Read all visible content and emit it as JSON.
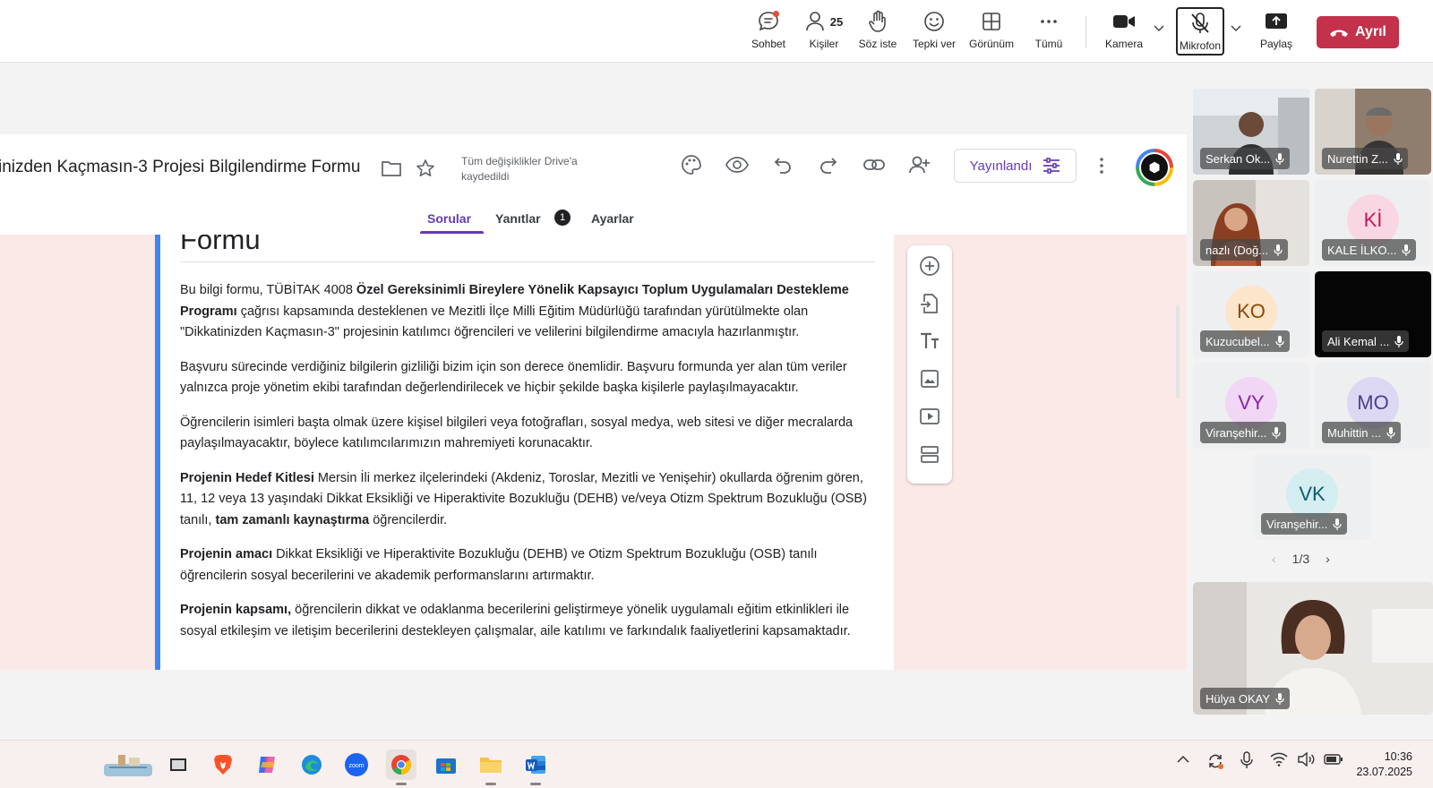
{
  "meeting_bar": {
    "chat": "Sohbet",
    "people": "Kişiler",
    "people_count": "25",
    "raise_hand": "Söz iste",
    "react": "Tepki ver",
    "view": "Görünüm",
    "more": "Tümü",
    "camera": "Kamera",
    "mic": "Mikrofon",
    "share": "Paylaş",
    "leave": "Ayrıl",
    "leave_color": "#c4314b"
  },
  "form_app": {
    "title": "inizden Kaçmasın-3 Projesi Bilgilendirme Formu",
    "saved_status": "Tüm değişiklikler Drive'a kaydedildi",
    "publish_label": "Yayınlandı",
    "accent_color": "#673ab7",
    "tabs": {
      "questions": "Sorular",
      "responses": "Yanıtlar",
      "responses_count": "1",
      "settings": "Ayarlar"
    },
    "form_heading": "Formu",
    "desc": {
      "p1_a": "Bu bilgi formu, TÜBİTAK 4008 ",
      "p1_b": "Özel Gereksinimli Bireylere Yönelik Kapsayıcı Toplum Uygulamaları Destekleme Programı",
      "p1_c": " çağrısı kapsamında desteklenen ve Mezitli İlçe Milli Eğitim Müdürlüğü tarafından yürütülmekte olan \"Dikkatinizden Kaçmasın-3\" projesinin katılımcı öğrencileri ve velilerini bilgilendirme amacıyla hazırlanmıştır.",
      "p2": "Başvuru sürecinde verdiğiniz bilgilerin gizliliği bizim için son derece önemlidir. Başvuru formunda yer alan tüm veriler yalnızca proje yönetim ekibi tarafından değerlendirilecek ve hiçbir şekilde başka kişilerle paylaşılmayacaktır.",
      "p3": "Öğrencilerin isimleri başta olmak üzere kişisel bilgileri veya fotoğrafları, sosyal medya, web sitesi ve diğer mecralarda paylaşılmayacaktır, böylece katılımcılarımızın mahremiyeti korunacaktır.",
      "p4_a": "Projenin Hedef Kitlesi",
      "p4_b": " Mersin İli merkez ilçelerindeki (Akdeniz, Toroslar, Mezitli ve Yenişehir) okullarda öğrenim gören, 11, 12 veya 13 yaşındaki Dikkat Eksikliği ve Hiperaktivite Bozukluğu (DEHB) ve/veya Otizm Spektrum Bozukluğu (OSB) tanılı, ",
      "p4_c": "tam zamanlı kaynaştırma",
      "p4_d": " öğrencilerdir.",
      "p5_a": "Projenin amacı",
      "p5_b": " Dikkat Eksikliği ve Hiperaktivite Bozukluğu (DEHB) ve Otizm Spektrum Bozukluğu (OSB) tanılı öğrencilerin sosyal becerilerini ve akademik performanslarını artırmaktır.",
      "p6_a": "Projenin kapsamı,",
      "p6_b": " öğrencilerin dikkat ve odaklanma becerilerini geliştirmeye yönelik uygulamalı eğitim etkinlikleri ile sosyal etkileşim ve iletişim becerilerini destekleyen çalışmalar, aile katılımı ve farkındalık faaliyetlerini kapsamaktadır."
    }
  },
  "participants": [
    {
      "name": "Serkan Ok...",
      "initials": "",
      "video": true
    },
    {
      "name": "Nurettin Z...",
      "initials": "",
      "video": true
    },
    {
      "name": "nazlı (Doğ...",
      "initials": "",
      "video": true
    },
    {
      "name": "KALE İLKO...",
      "initials": "Kİ",
      "color": "#c2185b",
      "bg": "#f8d7e3"
    },
    {
      "name": "Kuzucubel...",
      "initials": "KO",
      "color": "#8d4a00",
      "bg": "#fde5cc"
    },
    {
      "name": "Ali Kemal ...",
      "initials": "",
      "video": false
    },
    {
      "name": "Viranşehir...",
      "initials": "VY",
      "color": "#8e24aa",
      "bg": "#f1d7f5"
    },
    {
      "name": "Muhittin ...",
      "initials": "MO",
      "color": "#4a3f8f",
      "bg": "#dcd8f3"
    },
    {
      "name": "Viranşehir...",
      "initials": "VK",
      "color": "#0b5f6e",
      "bg": "#d4edf1"
    }
  ],
  "pager": "1/3",
  "self_view": {
    "name": "Hülya OKAY"
  },
  "taskbar": {
    "time": "10:36",
    "date": "23.07.2025",
    "apps": [
      "widgets-icon",
      "file-explorer-icon",
      "brave-icon",
      "copilot-icon",
      "edge-icon",
      "zoom-icon",
      "chrome-icon",
      "store-icon",
      "folder-icon",
      "word-icon"
    ]
  }
}
